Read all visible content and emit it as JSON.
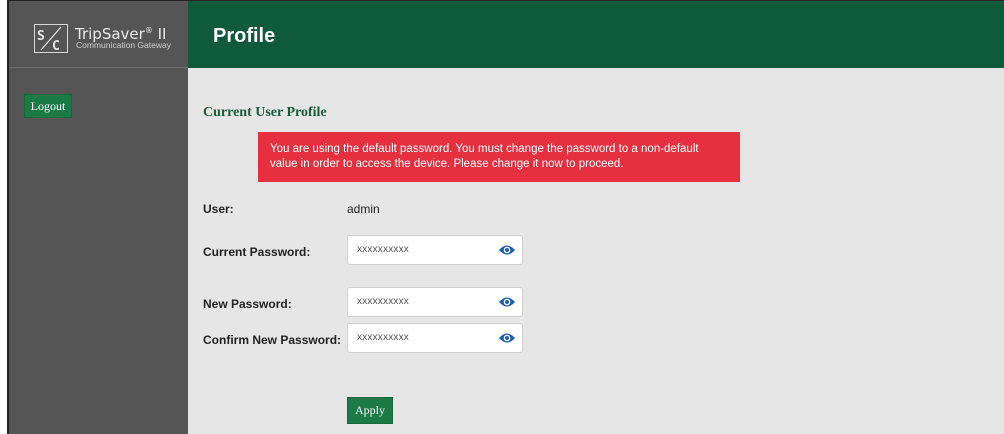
{
  "brand": {
    "logo_text": "S/C",
    "product": "TripSaver",
    "reg": "®",
    "suffix": " II",
    "subtitle": "Communication Gateway"
  },
  "sidebar": {
    "logout_label": "Logout"
  },
  "header": {
    "title": "Profile"
  },
  "profile": {
    "section_title": "Current User Profile",
    "alert_text": "You are using the default password. You must change the password to a non-default value in order to access the device. Please change it now to proceed.",
    "user_label": "User:",
    "user_value": "admin",
    "current_password_label": "Current Password:",
    "current_password_value": "xxxxxxxxxx",
    "new_password_label": "New Password:",
    "new_password_value": "xxxxxxxxxx",
    "confirm_password_label": "Confirm New Password:",
    "confirm_password_value": "xxxxxxxxxx",
    "apply_label": "Apply"
  },
  "colors": {
    "header_green": "#0f5a3a",
    "button_green": "#1b7a45",
    "alert_red": "#e63040",
    "sidebar_gray": "#555555",
    "eye_icon_blue": "#1f5fb0"
  },
  "icons": [
    "sc-logo-icon",
    "eye-icon"
  ]
}
